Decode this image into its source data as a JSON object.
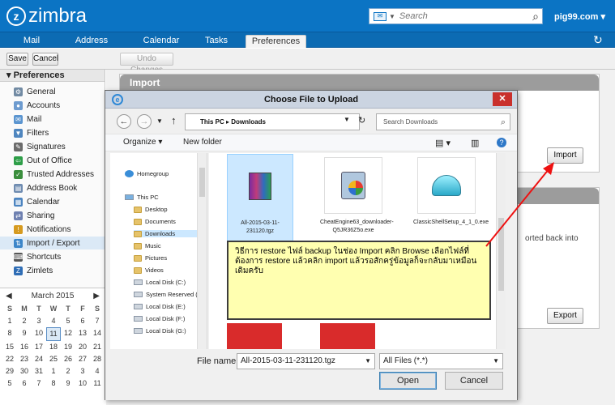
{
  "header": {
    "logo": "zimbra",
    "search_placeholder": "Search",
    "user": "pig99.com"
  },
  "tabs": [
    "Mail",
    "Address Book",
    "Calendar",
    "Tasks",
    "Preferences"
  ],
  "toolbar": {
    "save": "Save",
    "cancel": "Cancel",
    "undo": "Undo Changes"
  },
  "sidebar": {
    "title": "Preferences",
    "items": [
      "General",
      "Accounts",
      "Mail",
      "Filters",
      "Signatures",
      "Out of Office",
      "Trusted Addresses",
      "Address Book",
      "Calendar",
      "Sharing",
      "Notifications",
      "Import / Export",
      "Shortcuts",
      "Zimlets"
    ]
  },
  "calendar": {
    "month": "March 2015",
    "weekdays": [
      "S",
      "M",
      "T",
      "W",
      "T",
      "F",
      "S"
    ],
    "rows": [
      [
        "1",
        "2",
        "3",
        "4",
        "5",
        "6",
        "7"
      ],
      [
        "8",
        "9",
        "10",
        "11",
        "12",
        "13",
        "14"
      ],
      [
        "15",
        "16",
        "17",
        "18",
        "19",
        "20",
        "21"
      ],
      [
        "22",
        "23",
        "24",
        "25",
        "26",
        "27",
        "28"
      ],
      [
        "29",
        "30",
        "31",
        "1",
        "2",
        "3",
        "4"
      ],
      [
        "5",
        "6",
        "7",
        "8",
        "9",
        "10",
        "11"
      ]
    ],
    "today": "11"
  },
  "main": {
    "import_title": "Import",
    "import_button": "Import",
    "export_button": "Export",
    "partial_text": "orted back into"
  },
  "dialog": {
    "title": "Choose File to Upload",
    "path": [
      "This PC",
      "Downloads"
    ],
    "search": "Search Downloads",
    "organize": "Organize",
    "new_folder": "New folder",
    "tree": [
      "Homegroup",
      "This PC",
      "Desktop",
      "Documents",
      "Downloads",
      "Music",
      "Pictures",
      "Videos",
      "Local Disk (C:)",
      "System Reserved (D:)",
      "Local Disk (E:)",
      "Local Disk (F:)",
      "Local Disk (G:)"
    ],
    "files": [
      "All-2015-03-11-231120.tgz",
      "CheatEngine63_downloader-Q5JR36Z5o.exe",
      "ClassicShellSetup_4_1_0.exe"
    ],
    "file_name_label": "File name:",
    "file_name": "All-2015-03-11-231120.tgz",
    "file_type": "All Files (*.*)",
    "open": "Open",
    "cancel": "Cancel"
  },
  "note": "วิธีการ restore ไฟล์ backup ในช่อง Import คลิก Browse เลือกไฟล์ที่ต้องการ restore แล้วคลิก import แล้วรอสักครู่ข้อมูลก็จะกลับมาเหมือนเดิมครับ"
}
